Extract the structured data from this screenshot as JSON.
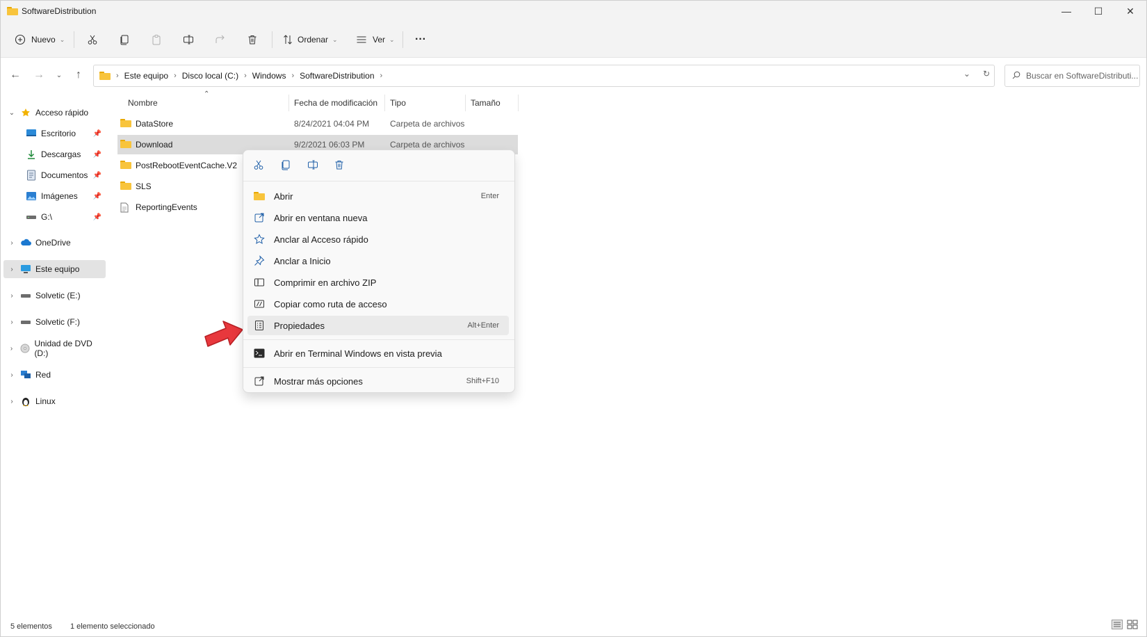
{
  "window": {
    "title": "SoftwareDistribution",
    "controls": {
      "minimize": "—",
      "maximize": "☐",
      "close": "✕"
    }
  },
  "toolbar": {
    "new_label": "Nuevo",
    "sort_label": "Ordenar",
    "view_label": "Ver",
    "more_label": "···"
  },
  "address": {
    "crumbs": [
      "Este equipo",
      "Disco local (C:)",
      "Windows",
      "SoftwareDistribution"
    ],
    "search_placeholder": "Buscar en SoftwareDistributi..."
  },
  "sidebar": {
    "items": [
      {
        "label": "Acceso rápido",
        "icon": "star-icon"
      },
      {
        "label": "Escritorio",
        "icon": "desktop-icon",
        "pinned": true
      },
      {
        "label": "Descargas",
        "icon": "download-icon",
        "pinned": true
      },
      {
        "label": "Documentos",
        "icon": "document-icon",
        "pinned": true
      },
      {
        "label": "Imágenes",
        "icon": "image-icon",
        "pinned": true
      },
      {
        "label": "G:\\",
        "icon": "drive-icon",
        "pinned": true
      },
      {
        "label": "OneDrive",
        "icon": "cloud-icon"
      },
      {
        "label": "Este equipo",
        "icon": "monitor-icon",
        "selected": true
      },
      {
        "label": "Solvetic (E:)",
        "icon": "drive-icon"
      },
      {
        "label": "Solvetic (F:)",
        "icon": "drive-icon"
      },
      {
        "label": "Unidad de DVD (D:)",
        "icon": "dvd-icon"
      },
      {
        "label": "Red",
        "icon": "network-icon"
      },
      {
        "label": "Linux",
        "icon": "linux-icon"
      }
    ]
  },
  "columns": {
    "name": "Nombre",
    "modified": "Fecha de modificación",
    "type": "Tipo",
    "size": "Tamaño"
  },
  "files": [
    {
      "name": "DataStore",
      "modified": "8/24/2021 04:04 PM",
      "type": "Carpeta de archivos"
    },
    {
      "name": "Download",
      "modified": "9/2/2021 06:03 PM",
      "type": "Carpeta de archivos"
    },
    {
      "name": "PostRebootEventCache.V2"
    },
    {
      "name": "SLS"
    },
    {
      "name": "ReportingEvents"
    }
  ],
  "context_menu": {
    "items": [
      {
        "label": "Abrir",
        "shortcut": "Enter"
      },
      {
        "label": "Abrir en ventana nueva"
      },
      {
        "label": "Anclar al Acceso rápido"
      },
      {
        "label": "Anclar a Inicio"
      },
      {
        "label": "Comprimir en archivo ZIP"
      },
      {
        "label": "Copiar como ruta de acceso"
      },
      {
        "label": "Propiedades",
        "shortcut": "Alt+Enter"
      },
      {
        "label": "Abrir en Terminal Windows en vista previa"
      },
      {
        "label": "Mostrar más opciones",
        "shortcut": "Shift+F10"
      }
    ]
  },
  "status": {
    "count": "5 elementos",
    "selected": "1 elemento seleccionado"
  },
  "colors": {
    "accent": "#0067c0",
    "folder": "#f8c43c",
    "arrow": "#e8383d"
  }
}
